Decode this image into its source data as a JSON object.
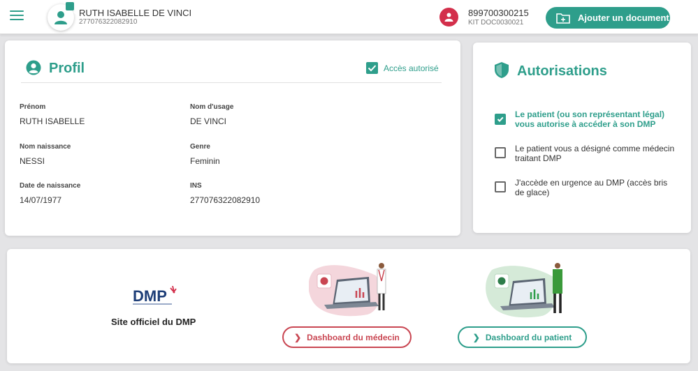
{
  "header": {
    "menu_icon": "hamburger-icon",
    "patient_name": "RUTH ISABELLE DE VINCI",
    "patient_ins": "277076322082910",
    "card_number": "899700300215",
    "kit_number": "KIT DOC0030021",
    "add_document_label": "Ajouter un document"
  },
  "profil": {
    "title": "Profil",
    "access_status": "Accès autorisé",
    "fields": [
      {
        "label": "Prénom",
        "value": "RUTH ISABELLE"
      },
      {
        "label": "Nom d'usage",
        "value": "DE VINCI"
      },
      {
        "label": "Nom naissance",
        "value": "NESSI"
      },
      {
        "label": "Genre",
        "value": "Feminin"
      },
      {
        "label": "Date de naissance",
        "value": "14/07/1977"
      },
      {
        "label": "INS",
        "value": "277076322082910"
      }
    ]
  },
  "autorisations": {
    "title": "Autorisations",
    "options": [
      {
        "text": "Le patient (ou son représentant légal) vous autorise à accéder à son DMP",
        "checked": true
      },
      {
        "text": "Le patient vous a désigné comme médecin traitant DMP",
        "checked": false
      },
      {
        "text": "J'accède en urgence au DMP (accès bris de glace)",
        "checked": false
      }
    ]
  },
  "bottom": {
    "logo_text": "DMP",
    "site_label": "Site officiel du DMP",
    "dashboard_medecin": "Dashboard du médecin",
    "dashboard_patient": "Dashboard du patient"
  },
  "colors": {
    "accent": "#2e9e8b",
    "danger": "#c94652",
    "card_red": "#d32f4b"
  }
}
